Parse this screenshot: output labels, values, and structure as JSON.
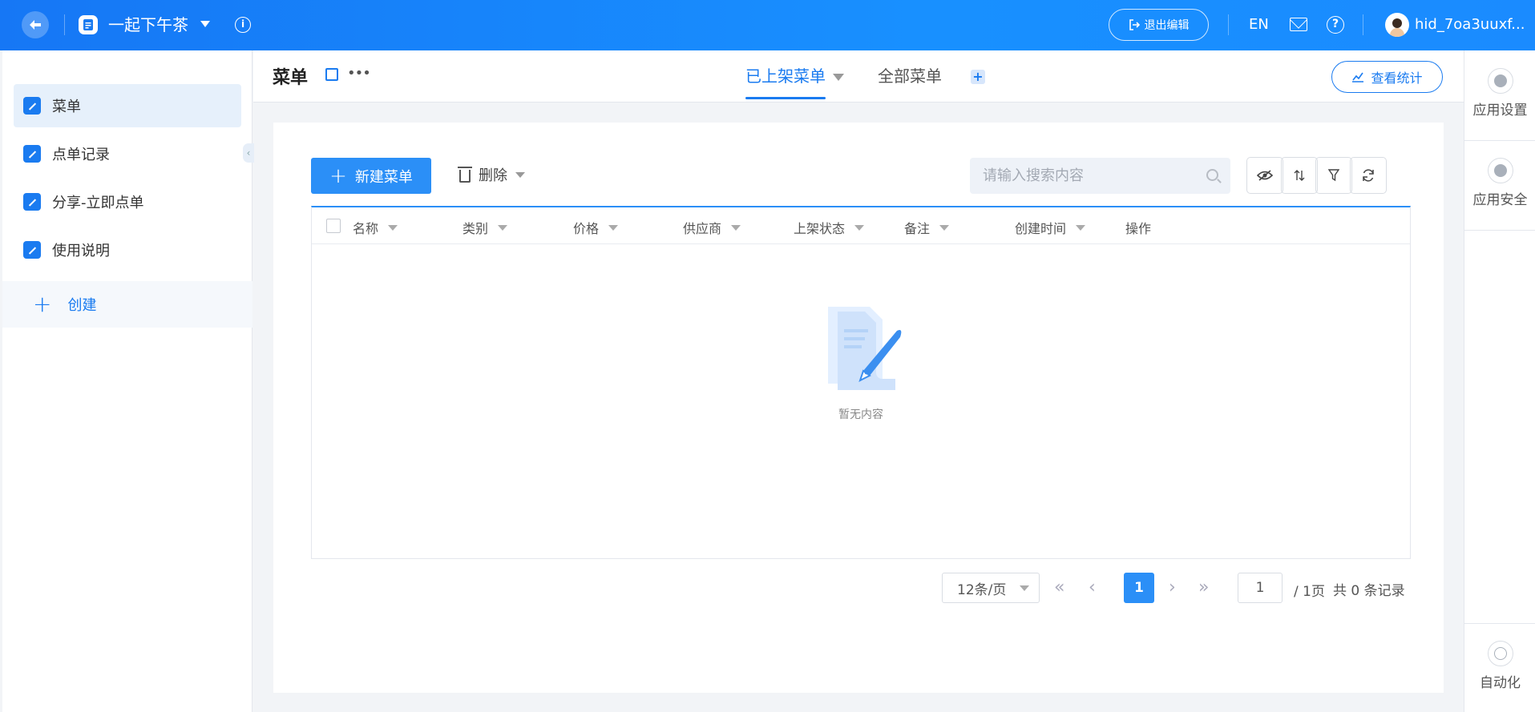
{
  "app": {
    "title": "一起下午茶"
  },
  "topbar": {
    "exit_label": "退出编辑",
    "lang": "EN",
    "username": "hid_7oa3uuxf..."
  },
  "sidebar": {
    "items": [
      {
        "label": "菜单"
      },
      {
        "label": "点单记录"
      },
      {
        "label": "分享-立即点单"
      },
      {
        "label": "使用说明"
      }
    ],
    "create_label": "创建"
  },
  "header": {
    "title": "菜单",
    "tabs": [
      {
        "label": "已上架菜单"
      },
      {
        "label": "全部菜单"
      }
    ],
    "stats_label": "查看统计"
  },
  "rail": {
    "items": [
      {
        "label": "应用设置"
      },
      {
        "label": "应用安全"
      },
      {
        "label": "自动化"
      }
    ]
  },
  "toolbar": {
    "new_label": "新建菜单",
    "delete_label": "删除",
    "search_placeholder": "请输入搜索内容"
  },
  "table": {
    "columns": [
      "名称",
      "类别",
      "价格",
      "供应商",
      "上架状态",
      "备注",
      "创建时间",
      "操作"
    ],
    "empty_text": "暂无内容"
  },
  "pagination": {
    "page_size": "12条/页",
    "current_page": "1",
    "jump_value": "1",
    "total_pages": "/ 1页",
    "total_records": "共 0 条记录"
  },
  "colors": {
    "primary": "#1a7bf0",
    "topbar": "#1890ff"
  }
}
